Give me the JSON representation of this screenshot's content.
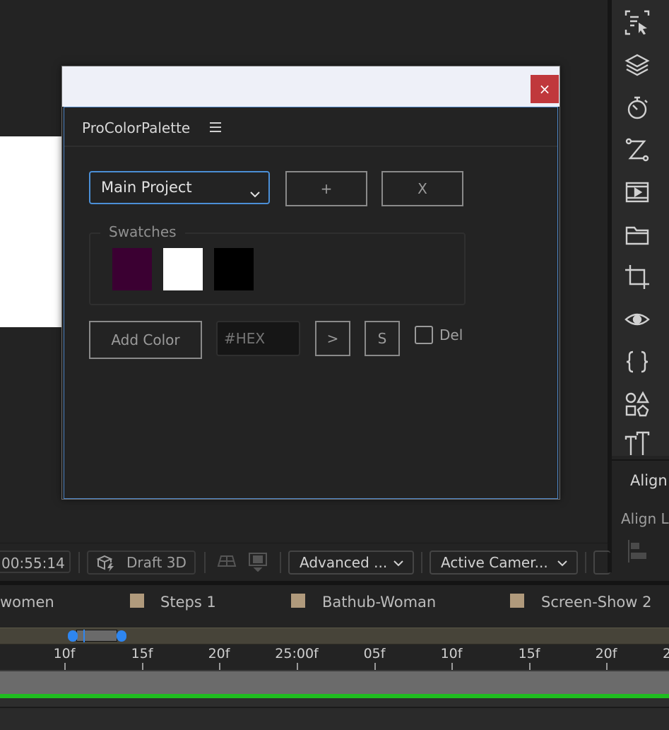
{
  "viewer": {
    "timecode": "00:55:14",
    "draft3d_label": "Draft 3D",
    "renderer_select": "Advanced ...",
    "camera_select": "Active Camer..."
  },
  "right_panel": {
    "align_tab": "Align",
    "align_layers_label": "Align L"
  },
  "timeline": {
    "layers": [
      "women",
      "Steps 1",
      "Bathub-Woman",
      "Screen-Show 2"
    ],
    "ticks": [
      "10f",
      "15f",
      "20f",
      "25:00f",
      "05f",
      "10f",
      "15f",
      "20f",
      "2"
    ],
    "layer_chip_color": "#b09a7c",
    "work_area_color": "#1fbd1f"
  },
  "dialog": {
    "close_label": "×",
    "panel_title": "ProColorPalette",
    "project_select": "Main Project",
    "add_project_label": "+",
    "delete_project_label": "X",
    "swatches_label": "Swatches",
    "swatches": [
      "#3b0032",
      "#ffffff",
      "#000000"
    ],
    "add_color_label": "Add Color",
    "hex_placeholder": "#HEX",
    "apply_label": ">",
    "s_label": "S",
    "del_label": "Del"
  }
}
